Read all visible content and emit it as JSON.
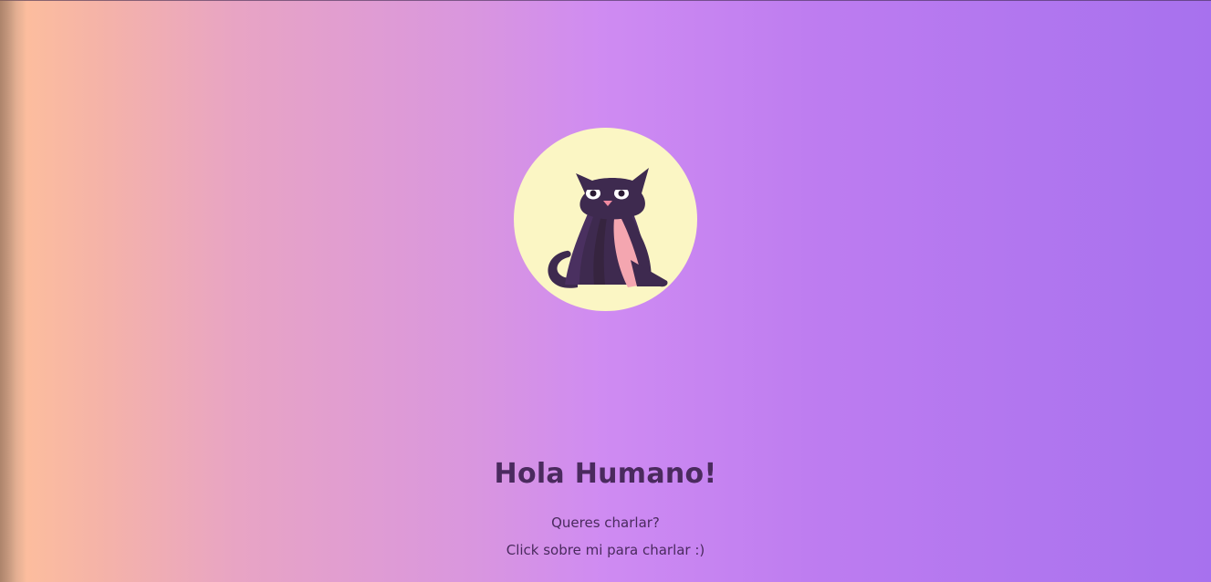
{
  "page": {
    "title": "Hola Humano!",
    "subtitle_line1": "Queres charlar?",
    "subtitle_line2": "Click sobre mi para charlar :)"
  },
  "avatar": {
    "icon": "cat-icon",
    "background_color": "#fbf6c4"
  },
  "colors": {
    "text": "#4a2a5e",
    "gradient_start": "#fcbd9e",
    "gradient_mid": "#cf8bf2",
    "gradient_end": "#a771ee",
    "cat_body": "#3e2a4f",
    "cat_chest": "#f4a6b0"
  }
}
